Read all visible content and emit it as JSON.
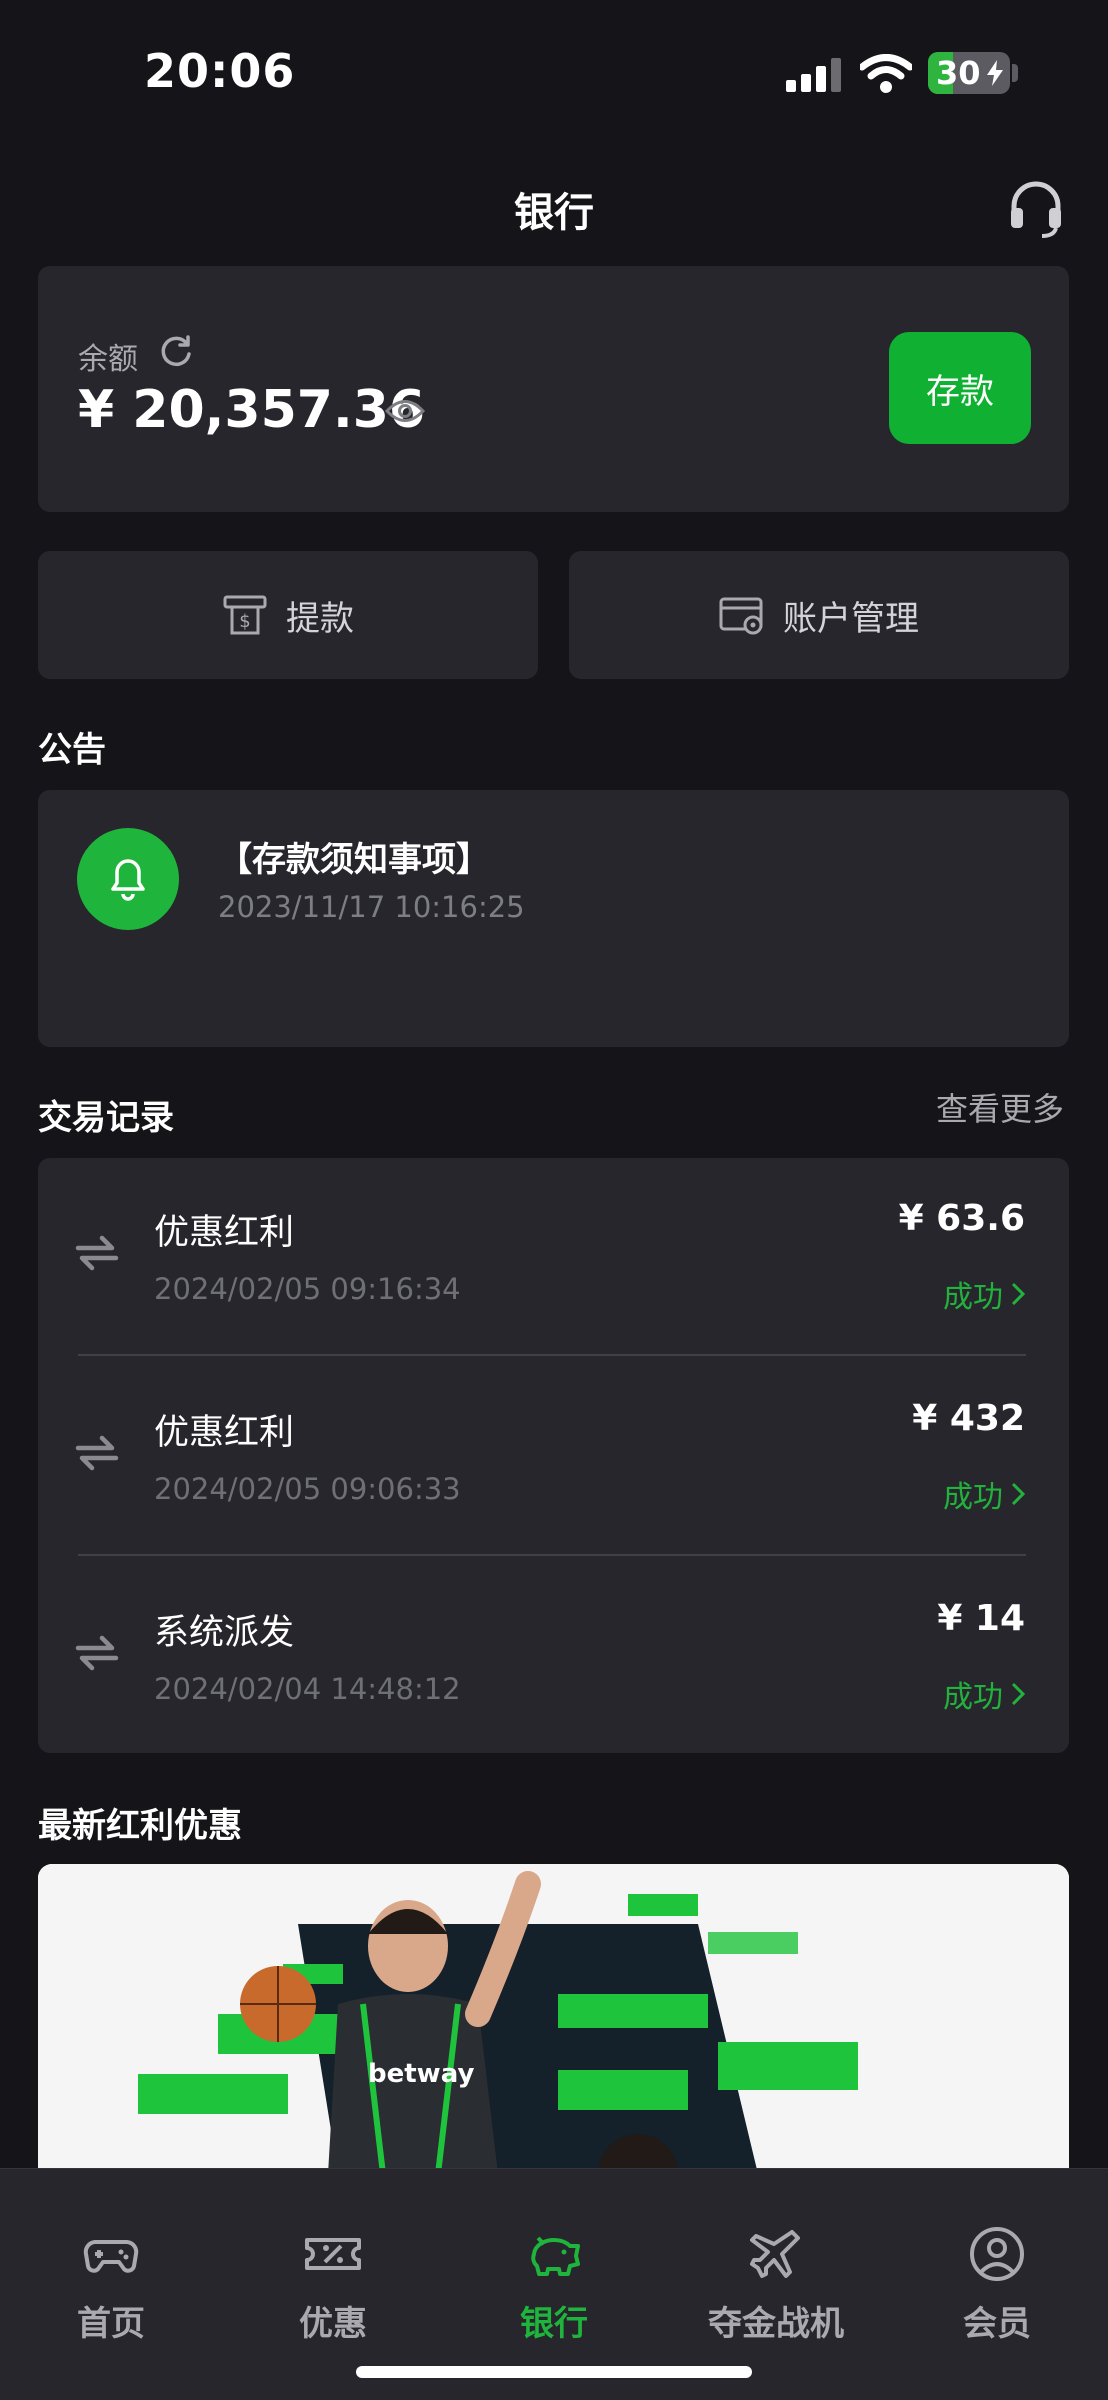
{
  "status_bar": {
    "time": "20:06",
    "battery": "30"
  },
  "header": {
    "title": "银行"
  },
  "balance": {
    "label": "余额",
    "amount": "¥ 20,357.36",
    "deposit_label": "存款"
  },
  "actions": {
    "withdraw_label": "提款",
    "account_label": "账户管理"
  },
  "notice": {
    "section_title": "公告",
    "title": "【存款须知事项】",
    "time": "2023/11/17 10:16:25"
  },
  "transactions": {
    "section_title": "交易记录",
    "more_label": "查看更多",
    "items": [
      {
        "name": "优惠红利",
        "time": "2024/02/05 09:16:34",
        "amount": "¥ 63.6",
        "status": "成功"
      },
      {
        "name": "优惠红利",
        "time": "2024/02/05 09:06:33",
        "amount": "¥ 432",
        "status": "成功"
      },
      {
        "name": "系统派发",
        "time": "2024/02/04 14:48:12",
        "amount": "¥ 14",
        "status": "成功"
      }
    ]
  },
  "promo": {
    "section_title": "最新红利优惠",
    "jersey_text": "betway"
  },
  "tabbar": {
    "items": [
      {
        "label": "首页",
        "icon": "gamepad-icon"
      },
      {
        "label": "优惠",
        "icon": "ticket-icon"
      },
      {
        "label": "银行",
        "icon": "piggy-bank-icon"
      },
      {
        "label": "夺金战机",
        "icon": "jet-icon"
      },
      {
        "label": "会员",
        "icon": "user-circle-icon"
      }
    ],
    "active": "银行"
  },
  "colors": {
    "accent": "#1fb43b",
    "background": "#141419",
    "card": "#26262c"
  }
}
